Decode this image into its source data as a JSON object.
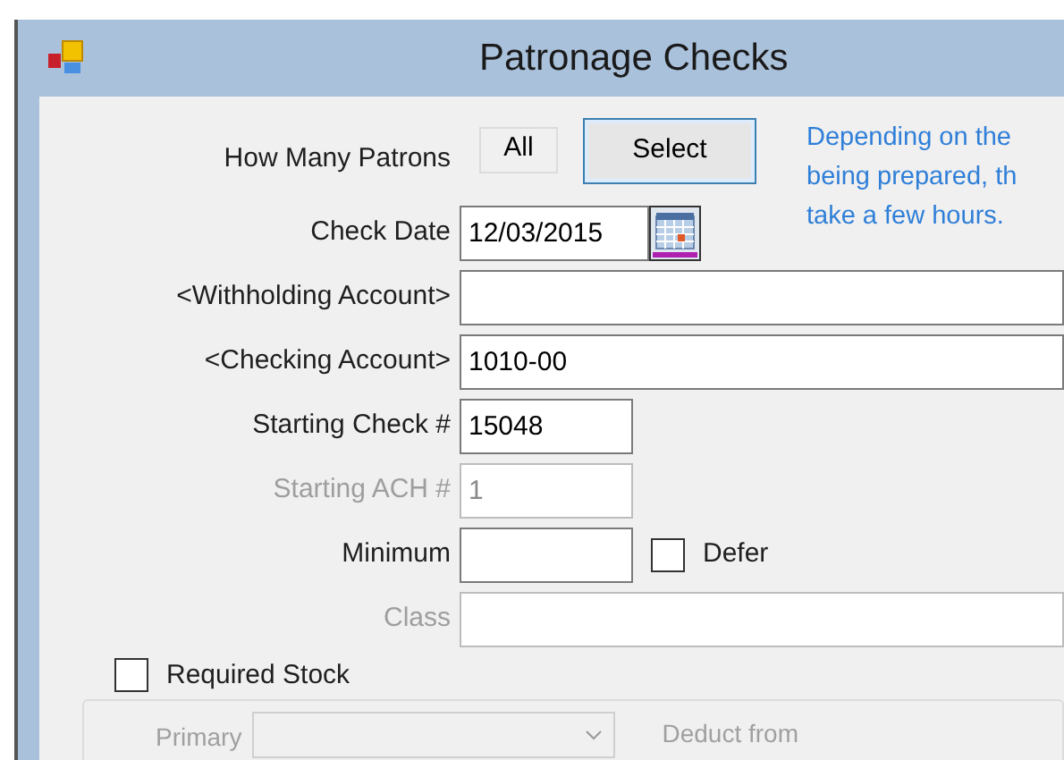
{
  "window": {
    "title": "Patronage Checks"
  },
  "patrons": {
    "label": "How Many Patrons",
    "value": "All",
    "button": "Select"
  },
  "info_lines": [
    "Depending on the",
    "being prepared, th",
    "take a few hours."
  ],
  "fields": [
    {
      "kind": "date",
      "label": "Check Date",
      "value": "12/03/2015",
      "disabled": false
    },
    {
      "kind": "wide",
      "label": "<Withholding Account>",
      "disabled": false
    },
    {
      "kind": "wide",
      "label": "<Checking Account>",
      "value": "1010-00",
      "disabled": false
    },
    {
      "kind": "short",
      "label": "Starting Check #",
      "value": "15048",
      "disabled": false
    },
    {
      "kind": "short",
      "label": "Starting ACH #",
      "value": "1",
      "disabled": true
    },
    {
      "kind": "short",
      "label": "Minimum",
      "disabled": false,
      "checkbox": {
        "label": "Defer",
        "checked": false
      }
    },
    {
      "kind": "wide",
      "label": "Class",
      "disabled": true
    }
  ],
  "required_stock": {
    "label": "Required Stock",
    "checked": false,
    "primary_label": "Primary",
    "deduct_from": "Deduct from"
  }
}
